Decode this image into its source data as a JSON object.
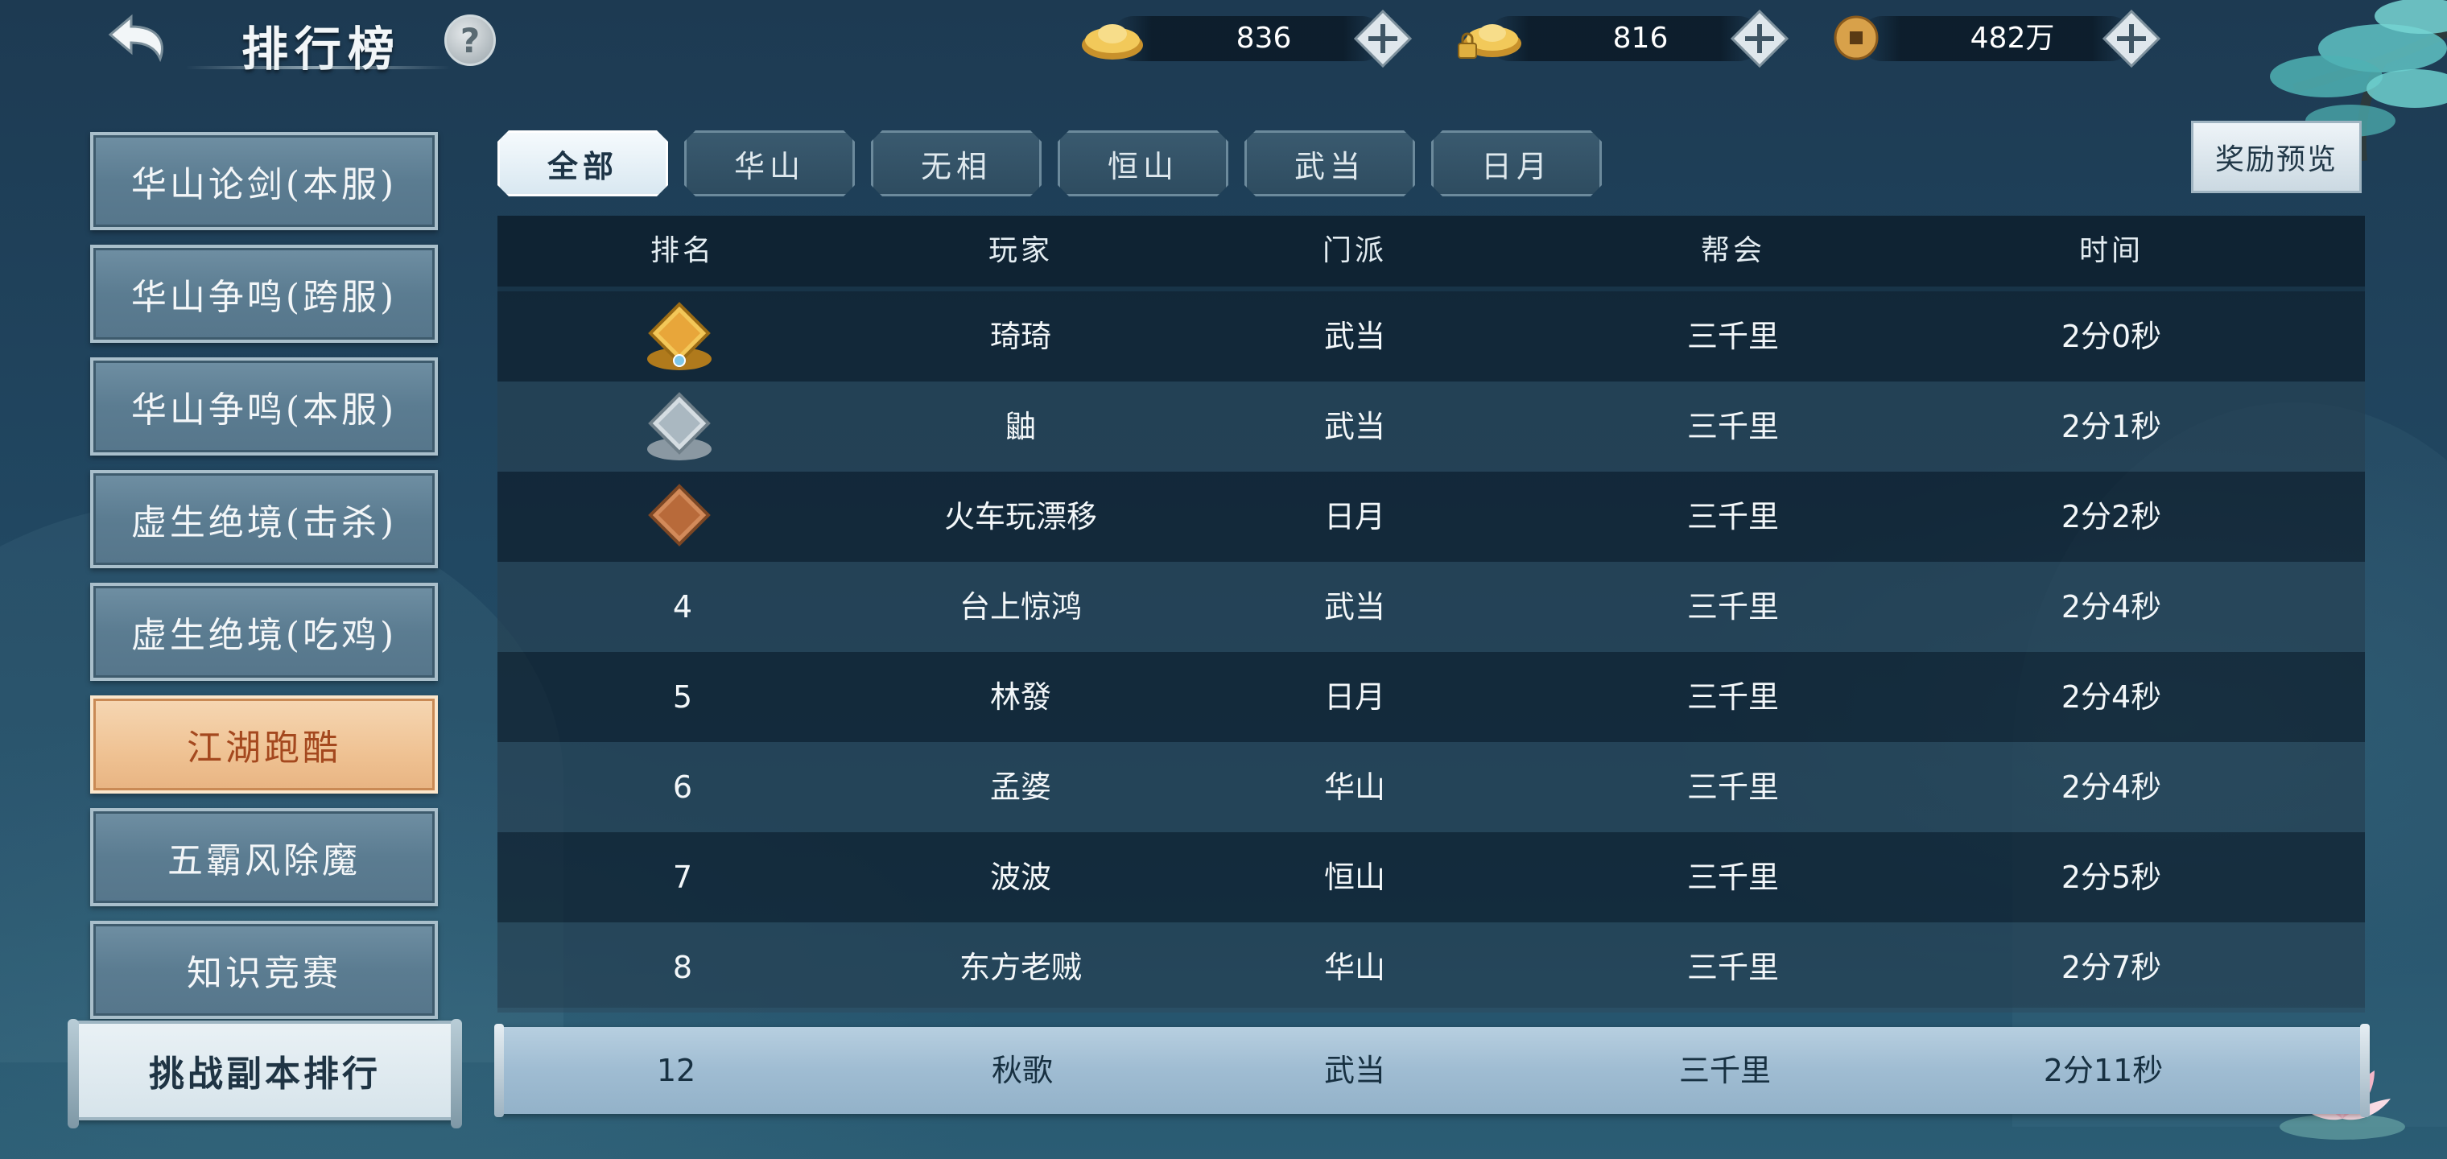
{
  "header": {
    "title": "排行榜",
    "help_label": "?",
    "back_icon": "back-arrow-icon"
  },
  "currencies": [
    {
      "name": "gold-ingot",
      "icon": "gold-ingot-icon",
      "value": "836"
    },
    {
      "name": "bound-gold-ingot",
      "icon": "locked-ingot-icon",
      "value": "816"
    },
    {
      "name": "copper-coin",
      "icon": "coin-icon",
      "value": "482万"
    }
  ],
  "sidebar": {
    "items": [
      {
        "label": "华山论剑(本服)",
        "active": false
      },
      {
        "label": "华山争鸣(跨服)",
        "active": false
      },
      {
        "label": "华山争鸣(本服)",
        "active": false
      },
      {
        "label": "虚生绝境(击杀)",
        "active": false
      },
      {
        "label": "虚生绝境(吃鸡)",
        "active": false
      },
      {
        "label": "江湖跑酷",
        "active": true
      },
      {
        "label": "五霸风除魔",
        "active": false
      },
      {
        "label": "知识竞赛",
        "active": false
      },
      {
        "label": "挑战副本排行",
        "active": false
      }
    ]
  },
  "tabs": [
    {
      "label": "全部",
      "active": true
    },
    {
      "label": "华山",
      "active": false
    },
    {
      "label": "无相",
      "active": false
    },
    {
      "label": "恒山",
      "active": false
    },
    {
      "label": "武当",
      "active": false
    },
    {
      "label": "日月",
      "active": false
    }
  ],
  "reward_button": {
    "label": "奖励预览"
  },
  "table": {
    "columns": [
      "排名",
      "玩家",
      "门派",
      "帮会",
      "时间"
    ],
    "rows": [
      {
        "rank": "1",
        "player": "琦琦",
        "sect": "武当",
        "guild": "三千里",
        "time": "2分0秒"
      },
      {
        "rank": "2",
        "player": "鼬",
        "sect": "武当",
        "guild": "三千里",
        "time": "2分1秒"
      },
      {
        "rank": "3",
        "player": "火车玩漂移",
        "sect": "日月",
        "guild": "三千里",
        "time": "2分2秒"
      },
      {
        "rank": "4",
        "player": "台上惊鸿",
        "sect": "武当",
        "guild": "三千里",
        "time": "2分4秒"
      },
      {
        "rank": "5",
        "player": "林發",
        "sect": "日月",
        "guild": "三千里",
        "time": "2分4秒"
      },
      {
        "rank": "6",
        "player": "孟婆",
        "sect": "华山",
        "guild": "三千里",
        "time": "2分4秒"
      },
      {
        "rank": "7",
        "player": "波波",
        "sect": "恒山",
        "guild": "三千里",
        "time": "2分5秒"
      },
      {
        "rank": "8",
        "player": "东方老贼",
        "sect": "华山",
        "guild": "三千里",
        "time": "2分7秒"
      }
    ]
  },
  "my_rank": {
    "rank": "12",
    "player": "秋歌",
    "sect": "武当",
    "guild": "三千里",
    "time": "2分11秒"
  },
  "colors": {
    "background": "#214761",
    "active_category": "#efc293",
    "active_category_text": "#a4481e",
    "gold_badge": "#e8b74a",
    "silver_badge": "#b9c4cc",
    "bronze_badge": "#c97b4e"
  }
}
